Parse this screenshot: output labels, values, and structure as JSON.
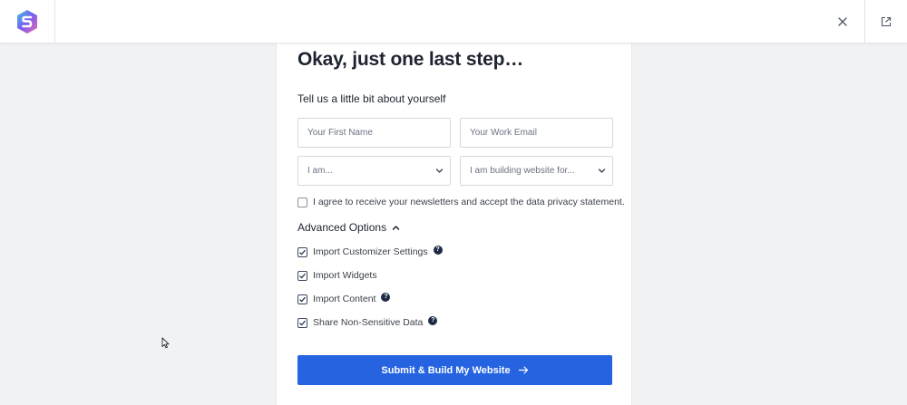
{
  "topbar": {
    "logo_icon": "starter-templates-logo-icon",
    "close_icon": "close-icon",
    "external_icon": "external-link-icon"
  },
  "form": {
    "heading": "Okay, just one last step…",
    "subheading": "Tell us a little bit about yourself",
    "first_name_placeholder": "Your First Name",
    "first_name_value": "",
    "email_placeholder": "Your Work Email",
    "email_value": "",
    "role_select_value": "I am...",
    "purpose_select_value": "I am building website for...",
    "newsletter_label": "I agree to receive your newsletters and accept the data privacy statement.",
    "newsletter_checked": false,
    "advanced_label": "Advanced Options",
    "advanced_expanded": true,
    "options": [
      {
        "label": "Import Customizer Settings",
        "checked": true,
        "help": true
      },
      {
        "label": "Import Widgets",
        "checked": true,
        "help": false
      },
      {
        "label": "Import Content",
        "checked": true,
        "help": true
      },
      {
        "label": "Share Non-Sensitive Data",
        "checked": true,
        "help": true
      }
    ],
    "submit_label": "Submit & Build My Website"
  },
  "colors": {
    "accent": "#2563e0",
    "help_icon_bg": "#1e2a46",
    "background": "#f1f2f4"
  }
}
